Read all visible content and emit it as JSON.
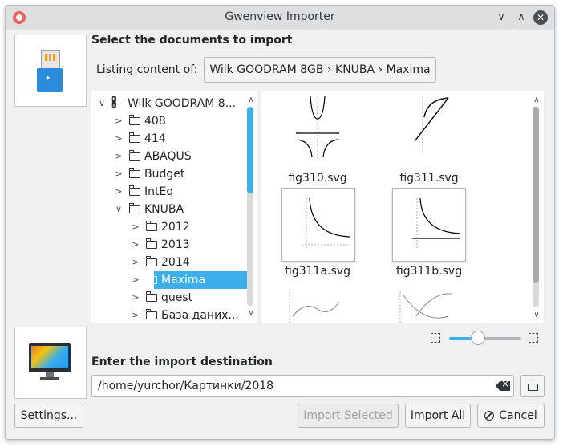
{
  "window": {
    "title": "Gwenview Importer"
  },
  "source": {
    "heading": "Select the documents to import",
    "listing_label": "Listing content of:",
    "path_button": "Wilk GOODRAM 8GB › KNUBA › Maxima"
  },
  "tree": {
    "root": "Wilk GOODRAM 8...",
    "items": [
      {
        "label": "408",
        "level": 1,
        "expanded": false
      },
      {
        "label": "414",
        "level": 1,
        "expanded": false
      },
      {
        "label": "ABAQUS",
        "level": 1,
        "expanded": false
      },
      {
        "label": "Budget",
        "level": 1,
        "expanded": false
      },
      {
        "label": "IntEq",
        "level": 1,
        "expanded": false
      },
      {
        "label": "KNUBA",
        "level": 1,
        "expanded": true
      },
      {
        "label": "2012",
        "level": 2,
        "expanded": false
      },
      {
        "label": "2013",
        "level": 2,
        "expanded": false
      },
      {
        "label": "2014",
        "level": 2,
        "expanded": false
      },
      {
        "label": "Maxima",
        "level": 2,
        "expanded": false,
        "selected": true
      },
      {
        "label": "quest",
        "level": 2,
        "expanded": false
      },
      {
        "label": "База даних...",
        "level": 2,
        "expanded": false
      }
    ]
  },
  "thumbnails": [
    {
      "name": "fig310.svg"
    },
    {
      "name": "fig311.svg"
    },
    {
      "name": "fig311a.svg"
    },
    {
      "name": "fig311b.svg"
    }
  ],
  "thumbnail_zoom": 0.4,
  "destination": {
    "heading": "Enter the import destination",
    "path": "/home/yurchor/Картинки/2018"
  },
  "buttons": {
    "settings": "Settings...",
    "import_selected": "Import Selected",
    "import_all": "Import All",
    "cancel": "Cancel"
  },
  "colors": {
    "accent": "#3daee9",
    "window_bg": "#eff0f1"
  }
}
